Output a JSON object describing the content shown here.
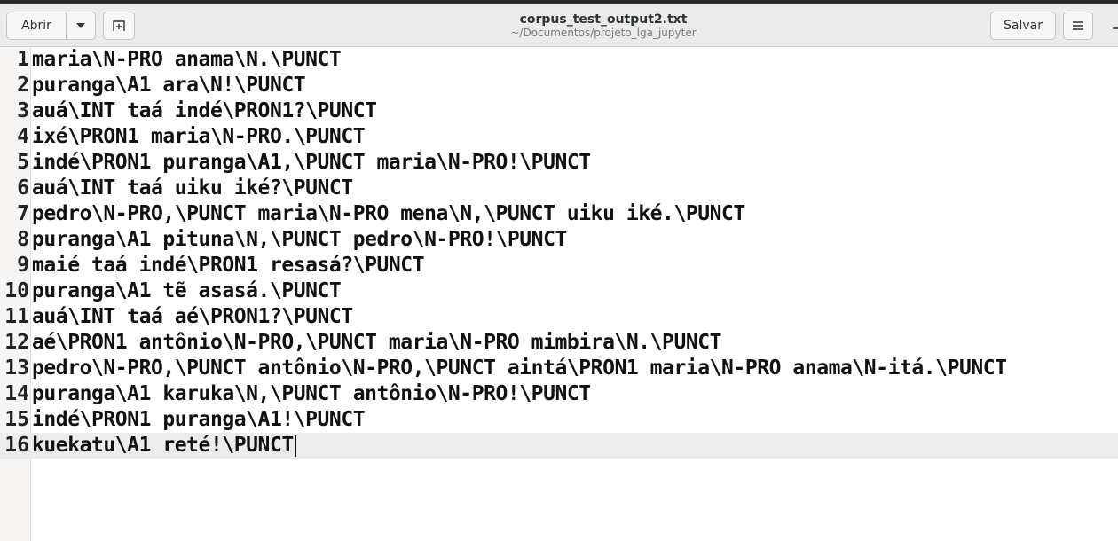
{
  "header": {
    "open_label": "Abrir",
    "save_label": "Salvar",
    "title": "corpus_test_output2.txt",
    "subtitle": "~/Documentos/projeto_lga_jupyter"
  },
  "editor": {
    "lines": [
      {
        "num": "1",
        "text": "maria\\N-PRO anama\\N.\\PUNCT"
      },
      {
        "num": "2",
        "text": "puranga\\A1 ara\\N!\\PUNCT"
      },
      {
        "num": "3",
        "text": "auá\\INT taá indé\\PRON1?\\PUNCT"
      },
      {
        "num": "4",
        "text": "ixé\\PRON1 maria\\N-PRO.\\PUNCT"
      },
      {
        "num": "5",
        "text": "indé\\PRON1 puranga\\A1,\\PUNCT maria\\N-PRO!\\PUNCT"
      },
      {
        "num": "6",
        "text": "auá\\INT taá uiku iké?\\PUNCT"
      },
      {
        "num": "7",
        "text": "pedro\\N-PRO,\\PUNCT maria\\N-PRO mena\\N,\\PUNCT uiku iké.\\PUNCT"
      },
      {
        "num": "8",
        "text": "puranga\\A1 pituna\\N,\\PUNCT pedro\\N-PRO!\\PUNCT"
      },
      {
        "num": "9",
        "text": "maié taá indé\\PRON1 resasá?\\PUNCT"
      },
      {
        "num": "10",
        "text": "puranga\\A1 tẽ asasá.\\PUNCT"
      },
      {
        "num": "11",
        "text": "auá\\INT taá aé\\PRON1?\\PUNCT"
      },
      {
        "num": "12",
        "text": "aé\\PRON1 antônio\\N-PRO,\\PUNCT maria\\N-PRO mimbira\\N.\\PUNCT"
      },
      {
        "num": "13",
        "text": "pedro\\N-PRO,\\PUNCT antônio\\N-PRO,\\PUNCT aintá\\PRON1 maria\\N-PRO anama\\N-itá.\\PUNCT"
      },
      {
        "num": "14",
        "text": "puranga\\A1 karuka\\N,\\PUNCT antônio\\N-PRO!\\PUNCT"
      },
      {
        "num": "15",
        "text": "indé\\PRON1 puranga\\A1!\\PUNCT"
      },
      {
        "num": "16",
        "text": "kuekatu\\A1 reté!\\PUNCT"
      }
    ]
  },
  "icons": {
    "open_dropdown": "chevron-down-icon",
    "new_tab": "new-tab-icon",
    "menu": "hamburger-menu-icon"
  },
  "colors": {
    "header_bg": "#ebebeb",
    "current_line_bg": "#ececec",
    "gutter_bg": "#f6f5f4"
  }
}
